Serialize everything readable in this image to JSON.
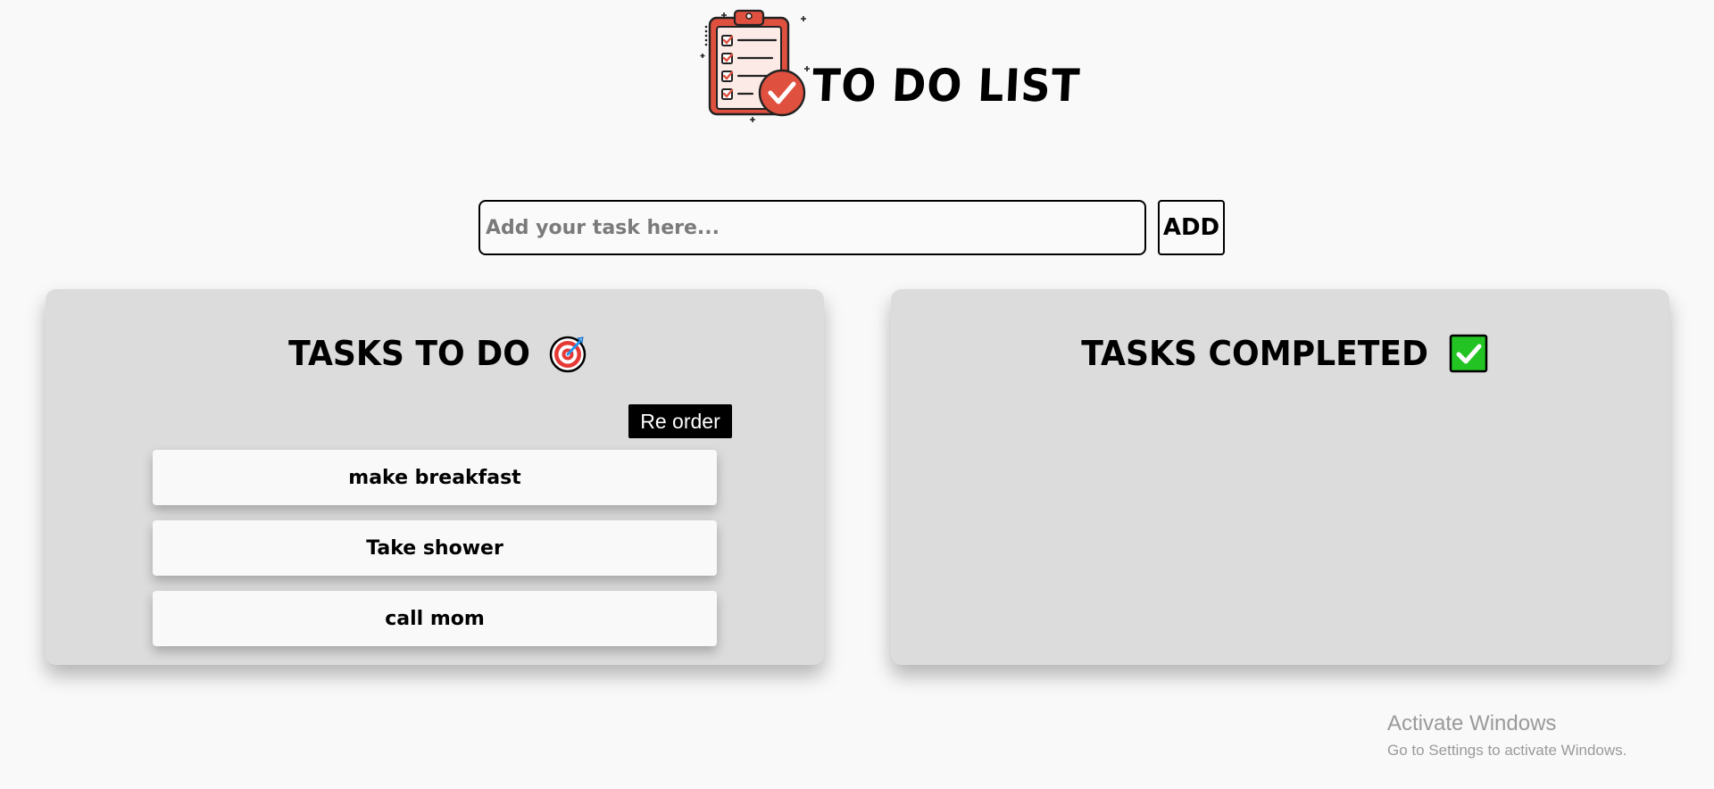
{
  "app": {
    "title": "TO DO LIST"
  },
  "input": {
    "placeholder": "Add your task here...",
    "value": ""
  },
  "add_button": {
    "label": "ADD"
  },
  "todo_panel": {
    "title": "TASKS TO DO",
    "icon": "direct-hit-target-icon",
    "reorder_label": "Re order",
    "tasks": [
      {
        "label": "make breakfast"
      },
      {
        "label": "Take shower"
      },
      {
        "label": "call mom"
      }
    ]
  },
  "done_panel": {
    "title": "TASKS COMPLETED",
    "icon": "check-mark-button-icon",
    "tasks": []
  },
  "watermark": {
    "title": "Activate Windows",
    "subtitle": "Go to Settings to activate Windows."
  },
  "colors": {
    "background": "#f9f9f9",
    "panel": "#dcdcdc",
    "logo_red": "#e0503f",
    "check_green": "#2ecc2e"
  }
}
